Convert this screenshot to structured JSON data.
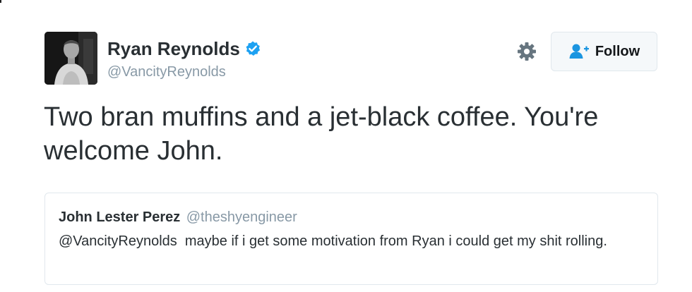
{
  "tweet": {
    "author": {
      "name": "Ryan Reynolds",
      "handle": "@VancityReynolds",
      "verified": true,
      "avatar": "avatar-photo"
    },
    "actions": {
      "settings_icon": "gear-icon",
      "follow_icon": "add-user-icon",
      "follow_label": "Follow"
    },
    "text": "Two bran muffins and a jet-black coffee. You're welcome John.",
    "quoted_tweet": {
      "name": "John Lester Perez",
      "handle": "@theshyengineer",
      "text": "@VancityReynolds  maybe if i get some motivation from Ryan i could get my shit rolling."
    }
  },
  "colors": {
    "verified_blue": "#1da1f2",
    "follow_icon_blue": "#1b95e0",
    "gear_gray": "#66757f",
    "handle_gray": "#8899a6",
    "text_dark": "#292f33",
    "border": "#e1e8ed",
    "button_bg": "#f5f8fa"
  }
}
